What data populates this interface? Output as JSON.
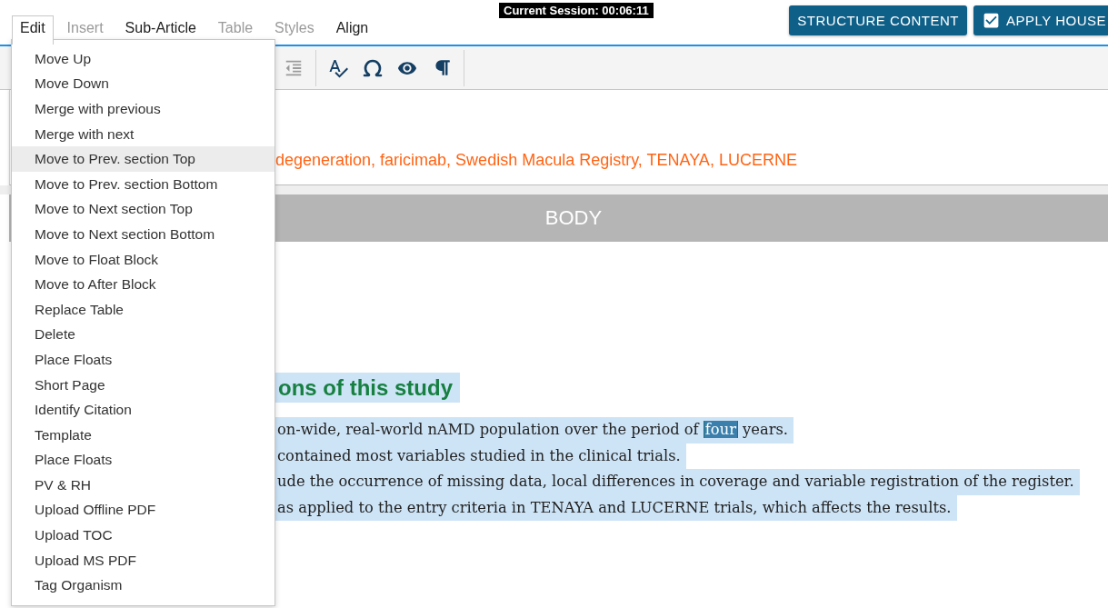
{
  "menubar": {
    "tabs": [
      {
        "label": "Edit",
        "selected": true,
        "disabled": false
      },
      {
        "label": "Insert",
        "selected": false,
        "disabled": true
      },
      {
        "label": "Sub-Article",
        "selected": false,
        "disabled": false
      },
      {
        "label": "Table",
        "selected": false,
        "disabled": true
      },
      {
        "label": "Styles",
        "selected": false,
        "disabled": true
      },
      {
        "label": "Align",
        "selected": false,
        "disabled": false
      }
    ]
  },
  "session": {
    "text": "Current Session: 00:06:11"
  },
  "actions": [
    {
      "kind": "plain",
      "label": "STRUCTURE CONTENT"
    },
    {
      "kind": "checkbox",
      "label": "APPLY HOUSE",
      "checked": true
    }
  ],
  "toolbar": {
    "tools": [
      {
        "kind": "outdent",
        "disabled": true
      },
      {
        "kind": "separator"
      },
      {
        "kind": "spellcheck",
        "disabled": false
      },
      {
        "kind": "special_characters",
        "disabled": false
      },
      {
        "kind": "preview",
        "disabled": false
      },
      {
        "kind": "formatting_marks",
        "disabled": false
      },
      {
        "kind": "separator"
      }
    ]
  },
  "keywords": {
    "text": "degeneration, faricimab, Swedish Macula Registry, TENAYA, LUCERNE"
  },
  "section_band": {
    "title": "BODY"
  },
  "section": {
    "heading": {
      "text": "ons of this study",
      "highlighted": true
    },
    "lines": [
      {
        "highlighted": true,
        "segments": [
          {
            "kind": "plain",
            "text": "on-wide, real-world nAMD population over the period of"
          },
          {
            "kind": "marked",
            "text": "four"
          },
          {
            "kind": "plain",
            "text": "years."
          }
        ]
      },
      {
        "highlighted": true,
        "segments": [
          {
            "kind": "plain",
            "text": "contained most variables studied in the clinical trials."
          }
        ]
      },
      {
        "highlighted": true,
        "segments": [
          {
            "kind": "plain",
            "text": "ude the occurrence of missing data, local differences in coverage and variable registration of the register."
          }
        ]
      },
      {
        "highlighted": true,
        "segments": [
          {
            "kind": "plain",
            "text": "as applied to the entry criteria in TENAYA and LUCERNE trials, which affects the results."
          }
        ]
      }
    ]
  },
  "edit_menu": {
    "items": [
      {
        "label": "Move Up",
        "selected": false
      },
      {
        "label": "Move Down",
        "selected": false
      },
      {
        "label": "Merge with previous",
        "selected": false
      },
      {
        "label": "Merge with next",
        "selected": false
      },
      {
        "label": "Move to Prev. section Top",
        "selected": true
      },
      {
        "label": "Move to Prev. section Bottom",
        "selected": false
      },
      {
        "label": "Move to Next section Top",
        "selected": false
      },
      {
        "label": "Move to Next section Bottom",
        "selected": false
      },
      {
        "label": "Move to Float Block",
        "selected": false
      },
      {
        "label": "Move to After Block",
        "selected": false
      },
      {
        "label": "Replace Table",
        "selected": false
      },
      {
        "label": "Delete",
        "selected": false
      },
      {
        "label": "Place Floats",
        "selected": false
      },
      {
        "label": "Short Page",
        "selected": false
      },
      {
        "label": "Identify Citation",
        "selected": false
      },
      {
        "label": "Template",
        "selected": false
      },
      {
        "label": "Place Floats",
        "selected": false
      },
      {
        "label": "PV & RH",
        "selected": false
      },
      {
        "label": "Upload Offline PDF",
        "selected": false
      },
      {
        "label": "Upload TOC",
        "selected": false
      },
      {
        "label": "Upload MS PDF",
        "selected": false
      },
      {
        "label": "Tag Organism",
        "selected": false
      }
    ]
  }
}
